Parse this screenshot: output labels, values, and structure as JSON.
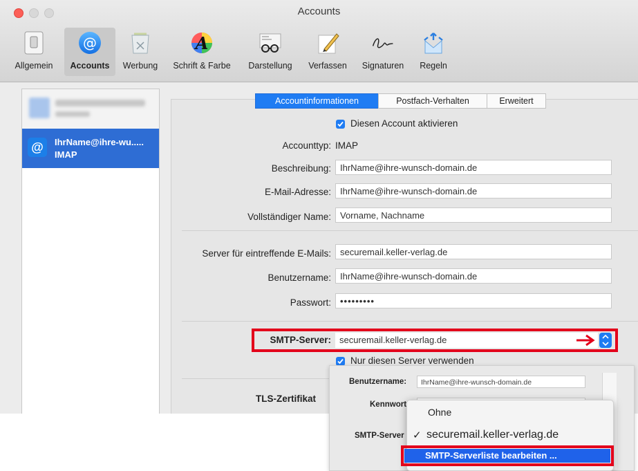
{
  "window": {
    "title": "Accounts"
  },
  "toolbar": {
    "items": [
      {
        "label": "Allgemein",
        "icon": "switch-icon"
      },
      {
        "label": "Accounts",
        "icon": "at-sign-icon"
      },
      {
        "label": "Werbung",
        "icon": "trash-icon"
      },
      {
        "label": "Schrift & Farbe",
        "icon": "font-color-icon"
      },
      {
        "label": "Darstellung",
        "icon": "glasses-icon"
      },
      {
        "label": "Verfassen",
        "icon": "pencil-icon"
      },
      {
        "label": "Signaturen",
        "icon": "signature-icon"
      },
      {
        "label": "Regeln",
        "icon": "rules-icon"
      }
    ]
  },
  "sidebar": {
    "accounts": [
      {
        "name": "IhrName@ihre-wu.....",
        "type": "IMAP"
      }
    ]
  },
  "tabs": [
    "Accountinformationen",
    "Postfach-Verhalten",
    "Erweitert"
  ],
  "form": {
    "enable_label": "Diesen Account aktivieren",
    "account_type_label": "Accounttyp:",
    "account_type_value": "IMAP",
    "description_label": "Beschreibung:",
    "description_value": "IhrName@ihre-wunsch-domain.de",
    "email_label": "E-Mail-Adresse:",
    "email_value": "IhrName@ihre-wunsch-domain.de",
    "fullname_label": "Vollständiger Name:",
    "fullname_value": "Vorname, Nachname",
    "incoming_label": "Server für eintreffende E-Mails:",
    "incoming_value": "securemail.keller-verlag.de",
    "username_label": "Benutzername:",
    "username_value": "IhrName@ihre-wunsch-domain.de",
    "password_label": "Passwort:",
    "password_value": "•••••••••",
    "smtp_label": "SMTP-Server:",
    "smtp_value": "securemail.keller-verlag.de",
    "only_server_label": "Nur diesen Server verwenden",
    "tls_label": "TLS-Zertifikat"
  },
  "popup": {
    "username_label": "Benutzername:",
    "username_value": "IhrName@ihre-wunsch-domain.de",
    "password_label": "Kennwort",
    "smtp_label": "SMTP-Server"
  },
  "menu": {
    "items": [
      "Ohne",
      "securemail.keller-verlag.de",
      "SMTP-Serverliste bearbeiten ..."
    ],
    "checkmark": "✓"
  },
  "colors": {
    "accent": "#1f7cf3",
    "highlight": "#e3001b",
    "selection": "#2e6dd4"
  }
}
